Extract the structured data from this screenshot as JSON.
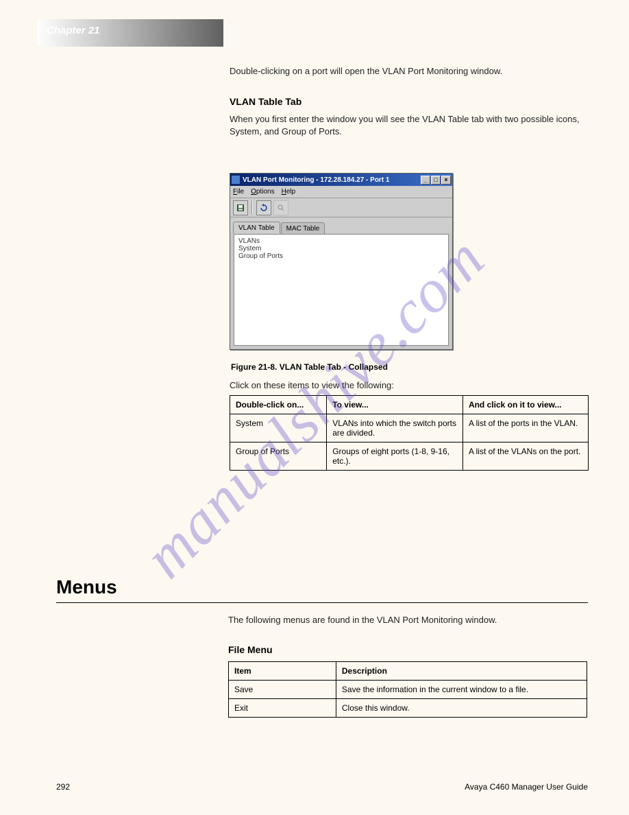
{
  "header": {
    "chapter": "Chapter 21"
  },
  "intro": "Double-clicking on a port will open the VLAN Port Monitoring window.",
  "section": {
    "title": "VLAN Table Tab",
    "paragraphs": [
      "When you first enter the window you will see the VLAN Table tab with two possible icons, System, and Group of Ports."
    ]
  },
  "screenshot": {
    "title": "VLAN Port Monitoring - 172.28.184.27 - Port 1",
    "menus": [
      "File",
      "Options",
      "Help"
    ],
    "tabs": {
      "active": "VLAN Table",
      "inactive": "MAC Table"
    },
    "content_lines": [
      "VLANs",
      "System",
      "Group of Ports"
    ],
    "toolbar_icons": [
      "save-icon",
      "refresh-icon",
      "search-icon"
    ]
  },
  "figure_caption": "Figure 21-8. VLAN Table Tab - Collapsed",
  "p3": "Click on these items to view the following:",
  "table1": {
    "headers": [
      "Double-click on...",
      "To view...",
      "And click on it to view..."
    ],
    "rows": [
      [
        "System",
        "VLANs into which the switch ports are divided.",
        "A list of the ports in the VLAN."
      ],
      [
        "Group of Ports",
        "Groups of eight ports (1-8, 9-16, etc.).",
        "A list of the VLANs on the port."
      ]
    ]
  },
  "menus": {
    "heading": "Menus",
    "intro": "The following menus are found in the VLAN Port Monitoring window.",
    "file_title": "File Menu",
    "table2": {
      "headers": [
        "Item",
        "Description"
      ],
      "rows": [
        [
          "Save",
          "Save the information in the current window to a file."
        ],
        [
          "Exit",
          "Close this window."
        ]
      ]
    }
  },
  "footer": {
    "page": "292",
    "doc": "Avaya C460 Manager User Guide"
  }
}
